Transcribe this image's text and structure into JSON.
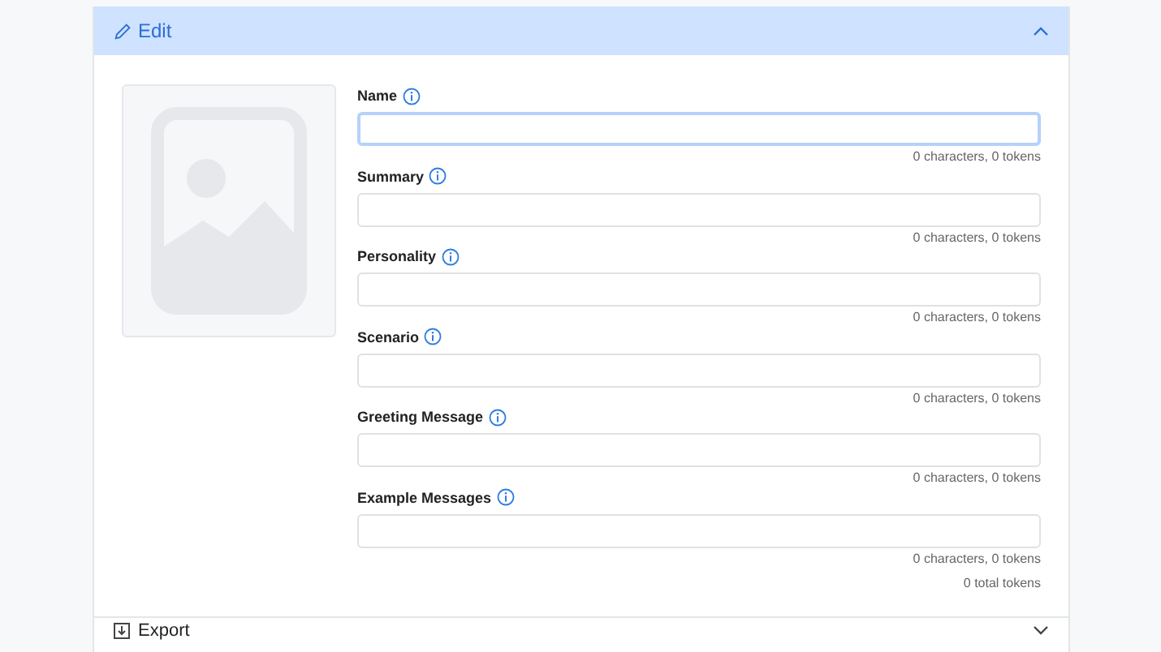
{
  "edit_section": {
    "title": "Edit",
    "expanded": true,
    "fields": [
      {
        "label": "Name",
        "focused": true,
        "counter": "0 characters, 0 tokens"
      },
      {
        "label": "Summary",
        "focused": false,
        "counter": "0 characters, 0 tokens"
      },
      {
        "label": "Personality",
        "focused": false,
        "counter": "0 characters, 0 tokens"
      },
      {
        "label": "Scenario",
        "focused": false,
        "counter": "0 characters, 0 tokens"
      },
      {
        "label": "Greeting Message",
        "focused": false,
        "counter": "0 characters, 0 tokens"
      },
      {
        "label": "Example Messages",
        "focused": false,
        "counter": "0 characters, 0 tokens"
      }
    ],
    "total": "0 total tokens"
  },
  "export_section": {
    "title": "Export"
  }
}
